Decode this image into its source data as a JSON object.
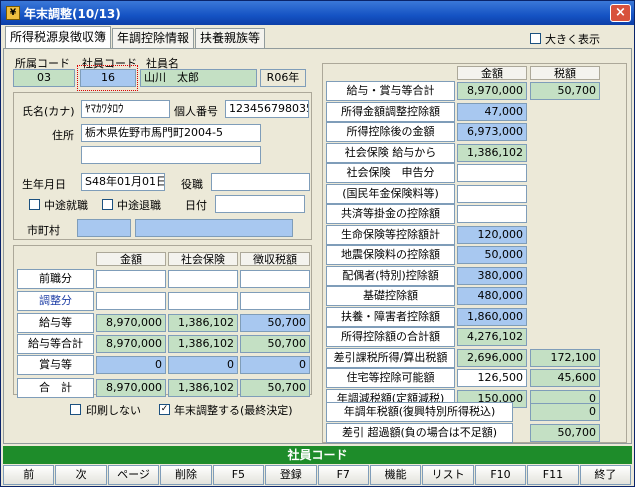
{
  "window": {
    "title": "年末調整(10/13)",
    "close": "×"
  },
  "tabs": [
    "所得税源泉徴収簿",
    "年調控除情報",
    "扶養親族等"
  ],
  "large_display_label": "大きく表示",
  "header": {
    "dept_label": "所属コード",
    "emp_code_label": "社員コード",
    "emp_name_label": "社員名",
    "dept_code": "03",
    "emp_code": "16",
    "emp_name": "山川　太郎",
    "year": "R06年"
  },
  "person": {
    "kana_label": "氏名(カナ)",
    "kana": "ﾔﾏｶﾜﾀﾛｳ",
    "mynumber_label": "個人番号",
    "mynumber": "123456798035",
    "address_label": "住所",
    "address1": "栃木県佐野市馬門町2004-5",
    "address2": "",
    "birth_label": "生年月日",
    "birth": "S48年01月01日",
    "position_label": "役職",
    "position": "",
    "mid_join": "中途就職",
    "mid_leave": "中途退職",
    "date_label": "日付",
    "date": "",
    "city_label": "市町村",
    "city1": "",
    "city2": ""
  },
  "left_table": {
    "headers": [
      "金額",
      "社会保険",
      "徴収税額"
    ],
    "rows": [
      {
        "label": "前職分",
        "blue": false,
        "v": [
          "",
          "",
          ""
        ],
        "style": [
          "w",
          "w",
          "w"
        ]
      },
      {
        "label": "調整分",
        "blue": true,
        "v": [
          "",
          "",
          ""
        ],
        "style": [
          "w",
          "w",
          "w"
        ]
      },
      {
        "label": "給与等",
        "blue": false,
        "v": [
          "8,970,000",
          "1,386,102",
          "50,700"
        ],
        "style": [
          "g",
          "g",
          "b"
        ]
      },
      {
        "label": "給与等合計",
        "blue": false,
        "v": [
          "8,970,000",
          "1,386,102",
          "50,700"
        ],
        "style": [
          "g",
          "g",
          "g"
        ]
      },
      {
        "label": "賞与等",
        "blue": false,
        "v": [
          "0",
          "0",
          "0"
        ],
        "style": [
          "b",
          "b",
          "b"
        ]
      },
      {
        "label": "合　計",
        "blue": false,
        "v": [
          "8,970,000",
          "1,386,102",
          "50,700"
        ],
        "style": [
          "g",
          "g",
          "g"
        ]
      }
    ]
  },
  "no_print": "印刷しない",
  "do_adjust": "年末調整する(最終決定)",
  "right_table": {
    "headers": [
      "金額",
      "税額"
    ],
    "rows": [
      {
        "label": "給与・賞与等合計",
        "amt": "8,970,000",
        "tax": "50,700",
        "as": "g",
        "ts": "g",
        "blue": false
      },
      {
        "label": "所得金額調整控除額",
        "amt": "47,000",
        "tax": "",
        "as": "b",
        "ts": "",
        "blue": false
      },
      {
        "label": "所得控除後の金額",
        "amt": "6,973,000",
        "tax": "",
        "as": "b",
        "ts": "",
        "blue": false
      },
      {
        "label": "社会保険 給与から",
        "amt": "1,386,102",
        "tax": "",
        "as": "g",
        "ts": "",
        "blue": false
      },
      {
        "label": "社会保険　申告分",
        "amt": "",
        "tax": "",
        "as": "w",
        "ts": "",
        "blue": false
      },
      {
        "label": "(国民年金保険料等)",
        "amt": "",
        "tax": "",
        "as": "w",
        "ts": "",
        "blue": false
      },
      {
        "label": "共済等掛金の控除額",
        "amt": "",
        "tax": "",
        "as": "w",
        "ts": "",
        "blue": false
      },
      {
        "label": "生命保険等控除額計",
        "amt": "120,000",
        "tax": "",
        "as": "b",
        "ts": "",
        "blue": false
      },
      {
        "label": "地震保険料の控除額",
        "amt": "50,000",
        "tax": "",
        "as": "b",
        "ts": "",
        "blue": false
      },
      {
        "label": "配偶者(特別)控除額",
        "amt": "380,000",
        "tax": "",
        "as": "b",
        "ts": "",
        "blue": false
      },
      {
        "label": "基礎控除額",
        "amt": "480,000",
        "tax": "",
        "as": "b",
        "ts": "",
        "blue": false
      },
      {
        "label": "扶養・障害者控除額",
        "amt": "1,860,000",
        "tax": "",
        "as": "b",
        "ts": "",
        "blue": false
      },
      {
        "label": "所得控除額の合計額",
        "amt": "4,276,102",
        "tax": "",
        "as": "g",
        "ts": "",
        "blue": false
      },
      {
        "label": "差引課税所得/算出税額",
        "amt": "2,696,000",
        "tax": "172,100",
        "as": "g",
        "ts": "g",
        "blue": false
      },
      {
        "label": "住宅等控除可能額",
        "amt": "126,500",
        "tax": "45,600",
        "as": "w",
        "ts": "g",
        "blue": false
      },
      {
        "label": "年調減税額(定額減税)",
        "amt": "150,000",
        "tax": "0",
        "as": "g",
        "ts": "g",
        "blue": false
      }
    ],
    "final1_label": "年調年税額(復興特別所得税込)",
    "final1_tax": "0",
    "final2_label": "差引 超過額(負の場合は不足額)",
    "final2_tax": "50,700"
  },
  "status_bar": "社員コード",
  "fkeys": [
    "前",
    "次",
    "ページ",
    "削除",
    "F5",
    "登録",
    "F7",
    "機能",
    "リスト",
    "F10",
    "F11",
    "終了"
  ]
}
